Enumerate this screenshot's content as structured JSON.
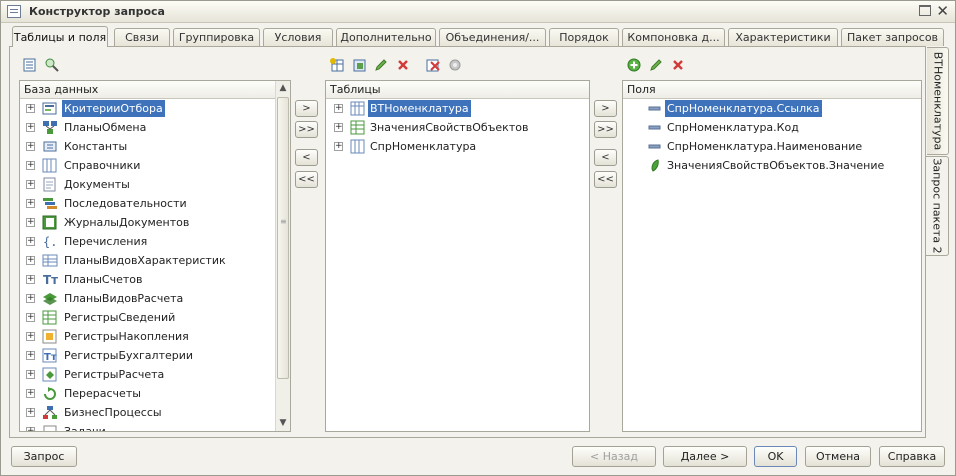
{
  "window": {
    "title": "Конструктор запроса"
  },
  "tabs": [
    {
      "label": "Таблицы и поля",
      "active": true
    },
    {
      "label": "Связи"
    },
    {
      "label": "Группировка"
    },
    {
      "label": "Условия"
    },
    {
      "label": "Дополнительно"
    },
    {
      "label": "Объединения/..."
    },
    {
      "label": "Порядок"
    },
    {
      "label": "Компоновка д..."
    },
    {
      "label": "Характеристики"
    },
    {
      "label": "Пакет запросов"
    }
  ],
  "side_tabs": [
    {
      "label": "ВТНоменклатура"
    },
    {
      "label": "Запрос пакета 2",
      "active": true
    }
  ],
  "database": {
    "header": "База данных",
    "items": [
      {
        "label": "КритерииОтбора",
        "icon": "criteria-icon",
        "selected": true
      },
      {
        "label": "ПланыОбмена",
        "icon": "exchange-plans-icon"
      },
      {
        "label": "Константы",
        "icon": "constants-icon"
      },
      {
        "label": "Справочники",
        "icon": "catalogs-icon"
      },
      {
        "label": "Документы",
        "icon": "documents-icon"
      },
      {
        "label": "Последовательности",
        "icon": "sequences-icon"
      },
      {
        "label": "ЖурналыДокументов",
        "icon": "document-journals-icon"
      },
      {
        "label": "Перечисления",
        "icon": "enums-icon"
      },
      {
        "label": "ПланыВидовХарактеристик",
        "icon": "chart-of-characteristic-types-icon"
      },
      {
        "label": "ПланыСчетов",
        "icon": "chart-of-accounts-icon"
      },
      {
        "label": "ПланыВидовРасчета",
        "icon": "calculation-types-icon"
      },
      {
        "label": "РегистрыСведений",
        "icon": "information-registers-icon"
      },
      {
        "label": "РегистрыНакопления",
        "icon": "accumulation-registers-icon"
      },
      {
        "label": "РегистрыБухгалтерии",
        "icon": "accounting-registers-icon"
      },
      {
        "label": "РегистрыРасчета",
        "icon": "calculation-registers-icon"
      },
      {
        "label": "Перерасчеты",
        "icon": "recalculations-icon"
      },
      {
        "label": "БизнесПроцессы",
        "icon": "business-processes-icon"
      },
      {
        "label": "Задачи",
        "icon": "tasks-icon"
      }
    ]
  },
  "tables": {
    "header": "Таблицы",
    "items": [
      {
        "label": "ВТНоменклатура",
        "selected": true
      },
      {
        "label": "ЗначенияСвойствОбъектов"
      },
      {
        "label": "СпрНоменклатура"
      }
    ]
  },
  "fields": {
    "header": "Поля",
    "items": [
      {
        "label": "СпрНоменклатура.Ссылка",
        "selected": true
      },
      {
        "label": "СпрНоменклатура.Код"
      },
      {
        "label": "СпрНоменклатура.Наименование"
      },
      {
        "label": "ЗначенияСвойствОбъектов.Значение"
      }
    ]
  },
  "move_buttons": {
    "add": ">",
    "add_all": ">>",
    "remove": "<",
    "remove_all": "<<"
  },
  "footer": {
    "query": "Запрос",
    "back": "< Назад",
    "next": "Далее >",
    "ok": "OK",
    "cancel": "Отмена",
    "help": "Справка"
  }
}
